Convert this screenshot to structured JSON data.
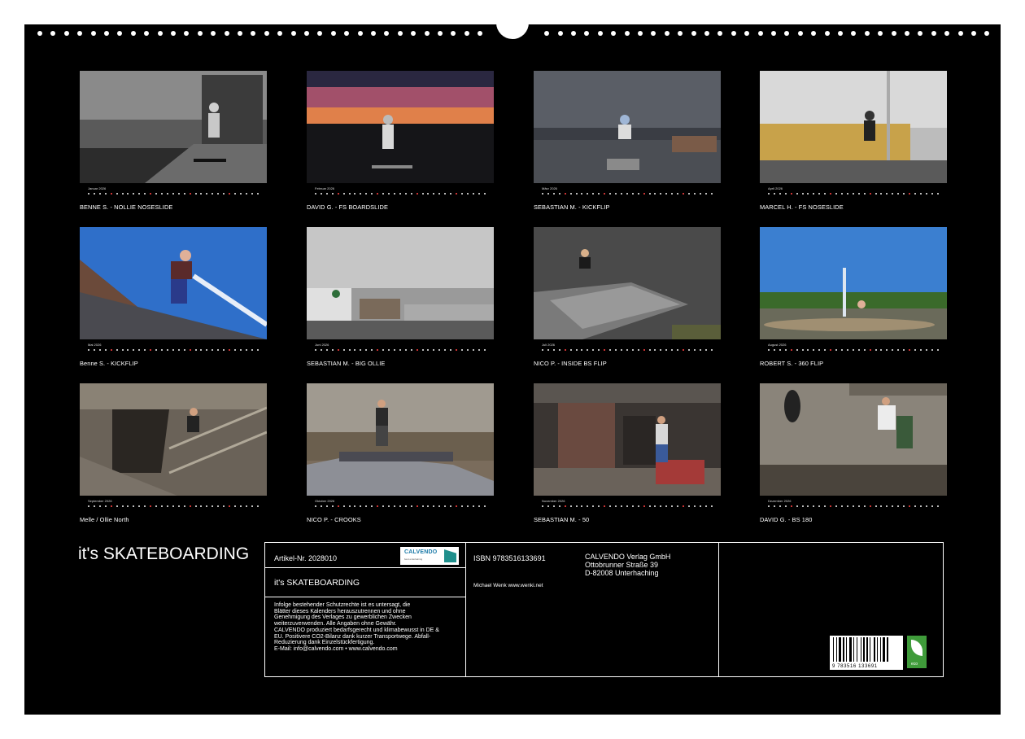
{
  "months": [
    {
      "name": "Januar 2026",
      "caption": "BENNE S. - NOLLIE NOSESLIDE"
    },
    {
      "name": "Februar 2026",
      "caption": "DAVID G. - FS BOARDSLIDE"
    },
    {
      "name": "März 2026",
      "caption": "SEBASTIAN M. - KICKFLIP"
    },
    {
      "name": "April 2026",
      "caption": "MARCEL H. - FS NOSESLIDE"
    },
    {
      "name": "Mai 2026",
      "caption": "Benne S. - KICKFLIP"
    },
    {
      "name": "Juni 2026",
      "caption": "SEBASTIAN M. - BIG OLLIE"
    },
    {
      "name": "Juli 2026",
      "caption": "NICO P. - INSIDE BS FLIP"
    },
    {
      "name": "August 2026",
      "caption": "ROBERT S. - 360 FLIP"
    },
    {
      "name": "September 2026",
      "caption": "Melle / Ollie North"
    },
    {
      "name": "Oktober 2026",
      "caption": "NICO P. - CROOKS"
    },
    {
      "name": "November 2026",
      "caption": "SEBASTIAN M. - 50"
    },
    {
      "name": "Dezember 2026",
      "caption": "DAVID G. - BS 180"
    }
  ],
  "title": "it's SKATEBOARDING",
  "info": {
    "artikel": "Artikel-Nr. 2028010",
    "logo_text": "CALVENDO",
    "logo_sub": "best entertaining",
    "subtitle": "it's SKATEBOARDING",
    "legal": [
      "Infolge bestehender Schutzrechte ist es untersagt, die",
      "Blätter dieses Kalenders herauszutrennen und ohne",
      "Genehmigung des Verlages zu gewerblichen Zwecken",
      "weiterzuverwenden. Alle Angaben ohne Gewähr.",
      "CALVENDO produziert bedarfsgerecht und klimabewusst in DE &",
      "EU. Positivere CO2-Bilanz dank kurzer Transportwege. Abfall-",
      "Reduzierung dank Einzelstückfertigung.",
      "E-Mail: info@calvendo.com • www.calvendo.com"
    ],
    "isbn": "ISBN 9783516133691",
    "author": "Michael Wenk www.wenki.net",
    "publisher": [
      "CALVENDO Verlag GmbH",
      "Ottobrunner Straße 39",
      "D-82008 Unterhaching"
    ],
    "barcode_digits": "9 783516 133691",
    "eco_label": "eco"
  },
  "colors": {
    "background": "#000000",
    "paper": "#ffffff",
    "eco_green": "#3f9b3a",
    "calvendo_blue": "#1a7aa8"
  }
}
